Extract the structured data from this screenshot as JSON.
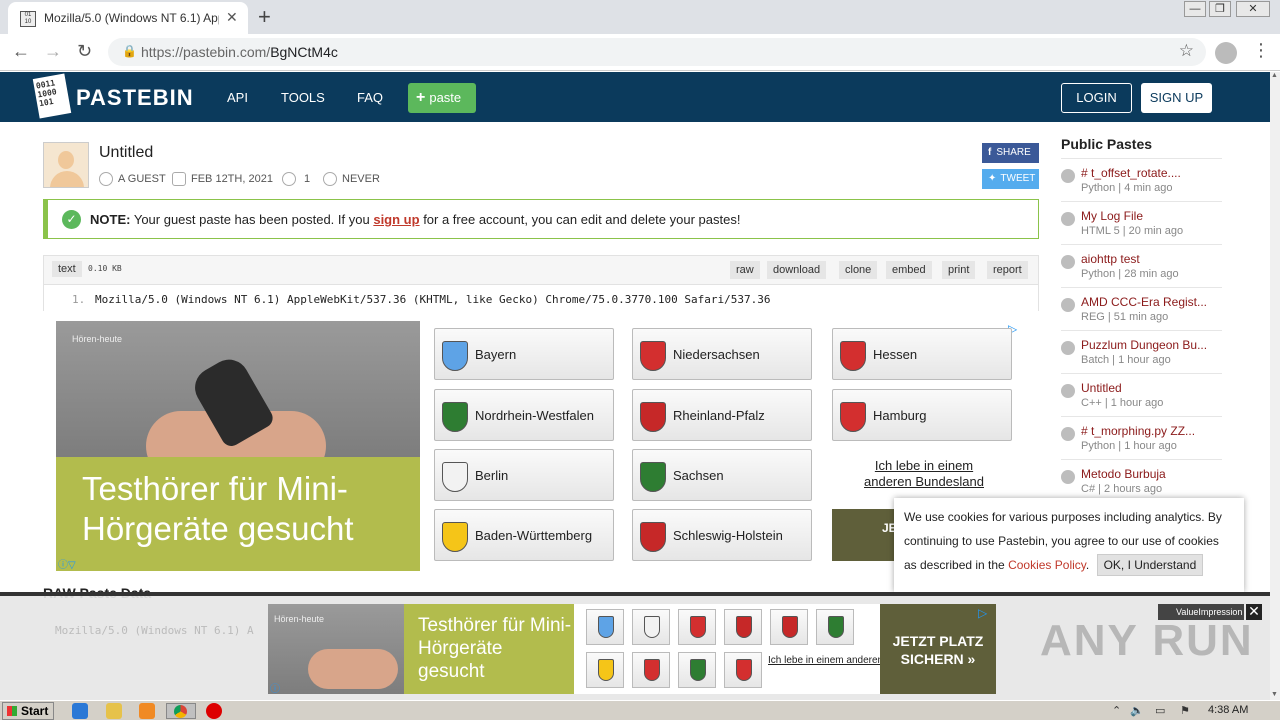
{
  "browser": {
    "tab_title": "Mozilla/5.0 (Windows NT 6.1) AppleWebKit",
    "tab_close": "✕",
    "new_tab": "+",
    "url_host": "https://pastebin.com/",
    "url_path": "BgNCtM4c",
    "window_controls": [
      "—",
      "❐",
      "✕"
    ]
  },
  "header": {
    "logo_mark": "0011\n1000\n101",
    "logo_text": "PASTEBIN",
    "nav": [
      "API",
      "TOOLS",
      "FAQ"
    ],
    "paste_button": "paste",
    "login": "LOGIN",
    "signup": "SIGN UP"
  },
  "paste": {
    "title": "Untitled",
    "author": "A GUEST",
    "date": "FEB 12TH, 2021",
    "views": "1",
    "expiry": "NEVER",
    "share": "SHARE",
    "tweet": "TWEET",
    "notice_bold": "NOTE:",
    "notice_before": "Your guest paste has been posted. If you",
    "notice_link": "sign up",
    "notice_after": "for a free account, you can edit and delete your pastes!",
    "language": "text",
    "size": "0.10 KB",
    "actions": [
      "raw",
      "download",
      "clone",
      "embed",
      "print",
      "report"
    ],
    "line_number": "1.",
    "line_text": "Mozilla/5.0 (Windows NT 6.1) AppleWebKit/537.36 (KHTML, like Gecko) Chrome/75.0.3770.100 Safari/537.36",
    "raw_heading": "RAW Paste Data",
    "raw_preview": "Mozilla/5.0 (Windows NT 6.1) A"
  },
  "ad": {
    "brand": "Hören-heute",
    "headline": "Testhörer für Mini-Hörgeräte gesucht",
    "states": [
      {
        "name": "Bayern",
        "color": "#5ea3e6"
      },
      {
        "name": "Niedersachsen",
        "color": "#d32f2f"
      },
      {
        "name": "Hessen",
        "color": "#d32f2f"
      },
      {
        "name": "Nordrhein-Westfalen",
        "color": "#2e7d32"
      },
      {
        "name": "Rheinland-Pfalz",
        "color": "#c62828"
      },
      {
        "name": "Hamburg",
        "color": "#d32f2f"
      },
      {
        "name": "Berlin",
        "color": "#f2f2f2"
      },
      {
        "name": "Sachsen",
        "color": "#2e7d32"
      },
      {
        "name": "Baden-Württemberg",
        "color": "#f5c518"
      },
      {
        "name": "Schleswig-Holstein",
        "color": "#c62828"
      }
    ],
    "other_state": "Ich lebe in einem anderen Bundesland",
    "cta_partial": "JE S",
    "sticky_headline": "Testhörer für Mini-Hörgeräte gesucht",
    "sticky_cta": "JETZT PLATZ SICHERN »",
    "sticky_other": "Ich lebe in einem anderen Bundesland",
    "sticky_badge": "ValueImpression"
  },
  "sidebar": {
    "title": "Public Pastes",
    "items": [
      {
        "name": "# t_offset_rotate....",
        "meta": "Python | 4 min ago"
      },
      {
        "name": "My Log File",
        "meta": "HTML 5 | 20 min ago"
      },
      {
        "name": "aiohttp test",
        "meta": "Python | 28 min ago"
      },
      {
        "name": "AMD CCC-Era Regist...",
        "meta": "REG | 51 min ago"
      },
      {
        "name": "Puzzlum Dungeon Bu...",
        "meta": "Batch | 1 hour ago"
      },
      {
        "name": "Untitled",
        "meta": "C++ | 1 hour ago"
      },
      {
        "name": "# t_morphing.py ZZ...",
        "meta": "Python | 1 hour ago"
      },
      {
        "name": "Metodo Burbuja",
        "meta": "C# | 2 hours ago"
      }
    ]
  },
  "cookie": {
    "text": "We use cookies for various purposes including analytics. By continuing to use Pastebin, you agree to our use of cookies as described in the",
    "link": "Cookies Policy",
    "button": "OK, I Understand"
  },
  "watermark": "ANY RUN",
  "taskbar": {
    "start": "Start",
    "clock": "4:38 AM"
  },
  "colors": {
    "header_bg": "#0b3a5c",
    "accent_green": "#5cb85c",
    "link_red": "#c0392b"
  }
}
